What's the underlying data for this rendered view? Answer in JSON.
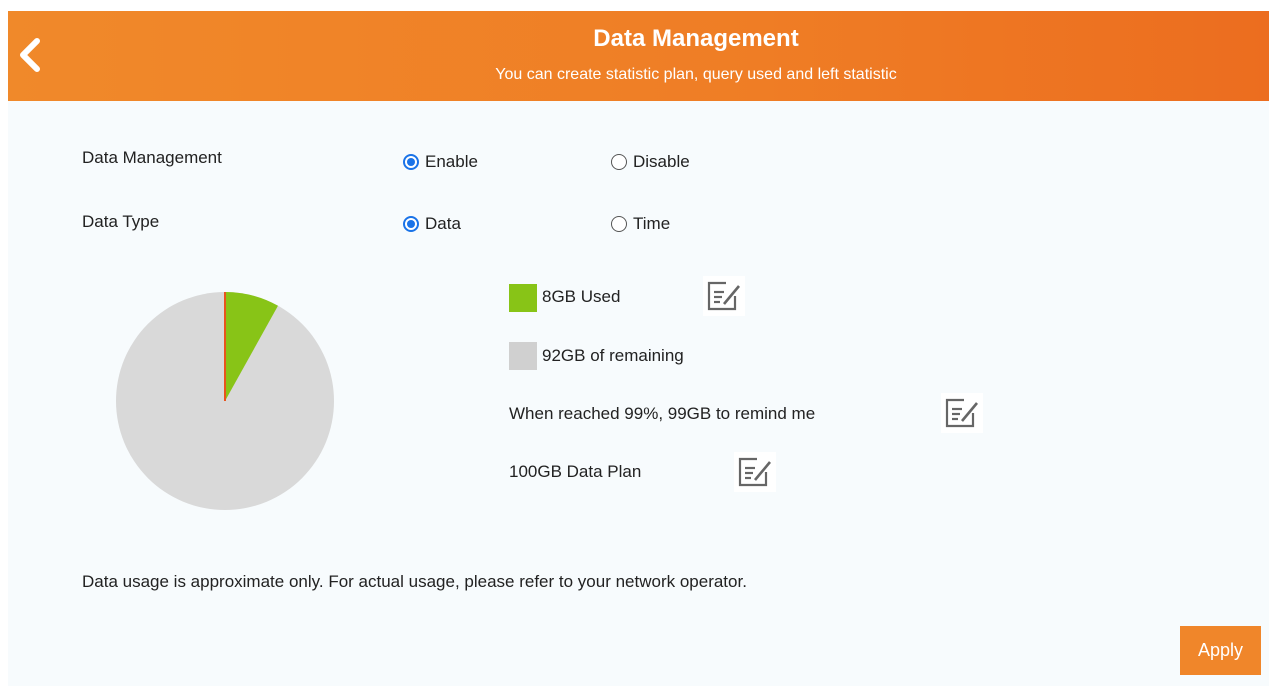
{
  "header": {
    "title": "Data Management",
    "subtitle": "You can create statistic plan, query used and left statistic",
    "back_icon": "chevron-left-icon"
  },
  "settings": {
    "data_management": {
      "label": "Data Management",
      "options": [
        "Enable",
        "Disable"
      ],
      "selected": "Enable"
    },
    "data_type": {
      "label": "Data Type",
      "options": [
        "Data",
        "Time"
      ],
      "selected": "Data"
    }
  },
  "usage": {
    "used_label": "8GB Used",
    "remaining_label": "92GB of remaining",
    "remind_label": "When reached 99%, 99GB to remind me",
    "plan_label": "100GB Data Plan",
    "used_gb": 8,
    "remaining_gb": 92,
    "plan_gb": 100,
    "edit_icon": "edit-icon"
  },
  "colors": {
    "header": "#ef7d25",
    "used": "#88c417",
    "remaining": "#d9d9d9",
    "marker": "#e8541e",
    "radio_checked": "#1a73e8",
    "apply": "#f0862a"
  },
  "note": "Data usage is approximate only. For actual usage, please refer to your network operator.",
  "apply_label": "Apply"
}
